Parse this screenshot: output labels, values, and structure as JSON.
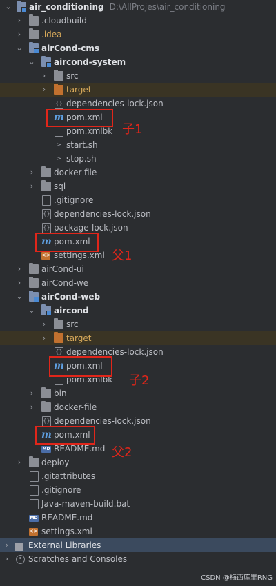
{
  "root": {
    "label": "air_conditioning",
    "path": "D:\\AllProjes\\air_conditioning"
  },
  "rows": [
    {
      "label": "air_conditioning",
      "note": "D:\\AllProjes\\air_conditioning"
    },
    {
      "label": ".cloudbuild"
    },
    {
      "label": ".idea"
    },
    {
      "label": "airCond-cms"
    },
    {
      "label": "aircond-system"
    },
    {
      "label": "src"
    },
    {
      "label": "target"
    },
    {
      "label": "dependencies-lock.json"
    },
    {
      "label": "pom.xml"
    },
    {
      "label": "pom.xmlbk"
    },
    {
      "label": "start.sh"
    },
    {
      "label": "stop.sh"
    },
    {
      "label": "docker-file"
    },
    {
      "label": "sql"
    },
    {
      "label": ".gitignore"
    },
    {
      "label": "dependencies-lock.json"
    },
    {
      "label": "package-lock.json"
    },
    {
      "label": "pom.xml"
    },
    {
      "label": "settings.xml"
    },
    {
      "label": "airCond-ui"
    },
    {
      "label": "airCond-we"
    },
    {
      "label": "airCond-web"
    },
    {
      "label": "aircond"
    },
    {
      "label": "src"
    },
    {
      "label": "target"
    },
    {
      "label": "dependencies-lock.json"
    },
    {
      "label": "pom.xml"
    },
    {
      "label": "pom.xmlbk"
    },
    {
      "label": "bin"
    },
    {
      "label": "docker-file"
    },
    {
      "label": "dependencies-lock.json"
    },
    {
      "label": "pom.xml"
    },
    {
      "label": "README.md"
    },
    {
      "label": "deploy"
    },
    {
      "label": ".gitattributes"
    },
    {
      "label": ".gitignore"
    },
    {
      "label": "Java-maven-build.bat"
    },
    {
      "label": "README.md"
    },
    {
      "label": "settings.xml"
    },
    {
      "label": "External Libraries"
    },
    {
      "label": "Scratches and Consoles"
    }
  ],
  "annotations": {
    "child1": "子1",
    "parent1": "父1",
    "child2": "子2",
    "parent2": "父2"
  },
  "watermark": "CSDN @梅西库里RNG",
  "colors": {
    "annotation": "#e0261a",
    "background": "#2b2d30",
    "selection": "#3b4a5e"
  }
}
